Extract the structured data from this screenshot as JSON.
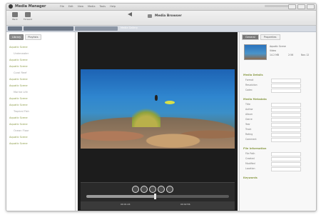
{
  "app": {
    "title": "Media Manager"
  },
  "menu": [
    "File",
    "Edit",
    "View",
    "Media",
    "Tools",
    "Help"
  ],
  "toolbar": {
    "back_label": "Back",
    "forward_label": "Forward",
    "now_playing": "Media Browser"
  },
  "pathbar": {
    "current": "Media Gallery"
  },
  "sidebar": {
    "tabs": [
      "Library",
      "Playlists"
    ],
    "items": [
      {
        "label": "Aquatic Scene",
        "sub": false
      },
      {
        "label": "Underwater",
        "sub": true
      },
      {
        "label": "Aquatic Scene",
        "sub": false
      },
      {
        "label": "Aquatic Scene",
        "sub": false
      },
      {
        "label": "Coral Reef",
        "sub": true
      },
      {
        "label": "Aquatic Scene",
        "sub": false
      },
      {
        "label": "Aquatic Scene",
        "sub": false
      },
      {
        "label": "Marine Life",
        "sub": true
      },
      {
        "label": "Aquatic Scene",
        "sub": false
      },
      {
        "label": "Aquatic Scene",
        "sub": false
      },
      {
        "label": "Tropical Fish",
        "sub": true
      },
      {
        "label": "Aquatic Scene",
        "sub": false
      },
      {
        "label": "Aquatic Scene",
        "sub": false
      },
      {
        "label": "Ocean Floor",
        "sub": true
      },
      {
        "label": "Aquatic Scene",
        "sub": false
      },
      {
        "label": "Aquatic Scene",
        "sub": false
      }
    ]
  },
  "player": {
    "progress": 0.48,
    "time_current": "00:01:24",
    "time_total": "00:02:56"
  },
  "rpanel": {
    "tabs": [
      "General",
      "Properties"
    ],
    "meta": {
      "name": "Aquatic Scene",
      "type": "Video",
      "size": "14.2 MB",
      "duration": "2:56",
      "date": "Nov 12"
    },
    "sections": [
      {
        "title": "Media Details",
        "fields": [
          "Format",
          "Resolution",
          "Codec"
        ]
      },
      {
        "title": "Media Metadata",
        "fields": [
          "Title",
          "Author",
          "Album",
          "Genre",
          "Year",
          "Track",
          "Rating",
          "Comment"
        ]
      },
      {
        "title": "File Information",
        "fields": [
          "File Path",
          "Created",
          "Modified",
          "Location"
        ]
      },
      {
        "title": "Keywords",
        "fields": []
      }
    ]
  },
  "colors": {
    "accent": "#8a9a46",
    "player_bg": "#1c1c1c",
    "water": "#2f86cf"
  }
}
